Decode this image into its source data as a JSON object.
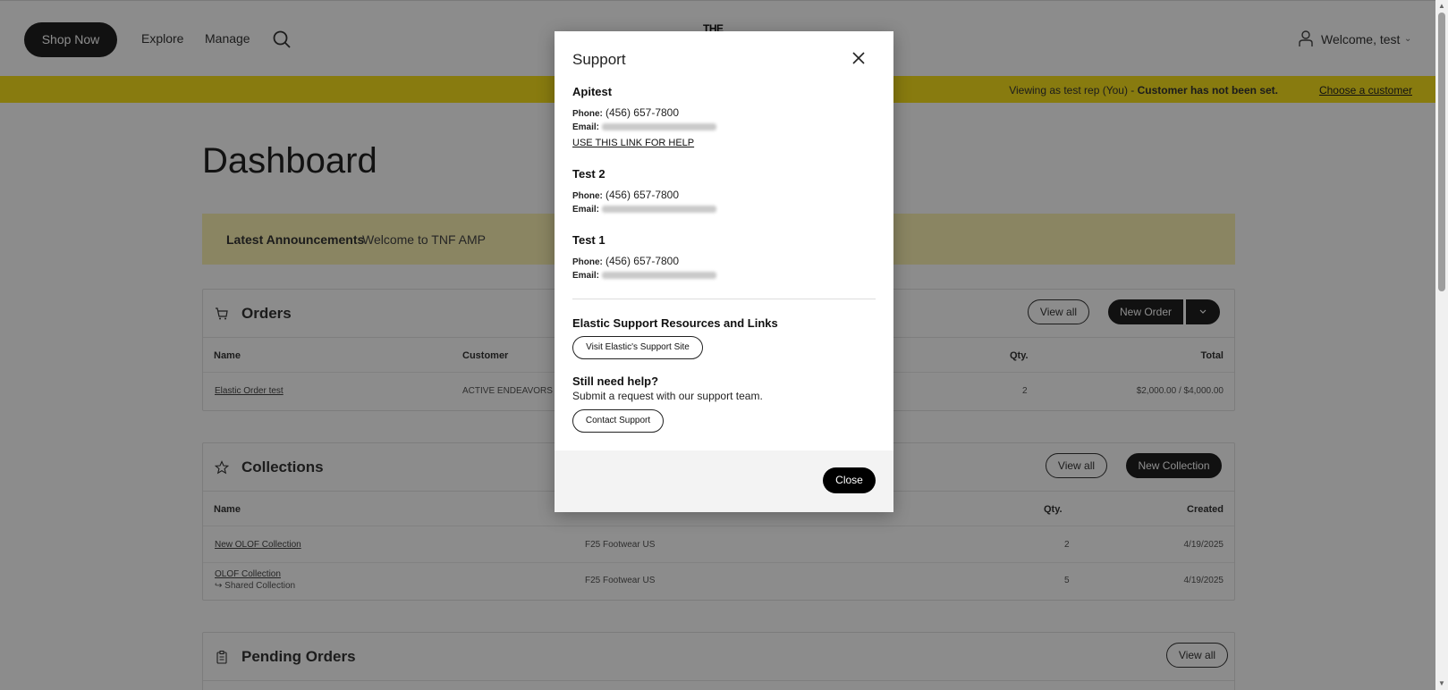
{
  "header": {
    "shop_now": "Shop Now",
    "explore": "Explore",
    "manage": "Manage",
    "logo_text": "THE",
    "welcome": "Welcome, test",
    "caret": "⌄"
  },
  "banner": {
    "viewing_as": "Viewing as test rep (You) - ",
    "customer_status": "Customer has not been set.",
    "choose_customer": "Choose a customer",
    "color": "#f7e11d"
  },
  "main": {
    "title": "Dashboard",
    "announcements": {
      "label": "Latest Announcements",
      "text": "Welcome to TNF AMP"
    }
  },
  "orders": {
    "title": "Orders",
    "view_all": "View all",
    "new_order": "New Order",
    "columns": {
      "name": "Name",
      "customer": "Customer",
      "qty": "Qty.",
      "total": "Total"
    },
    "rows": [
      {
        "name": "Elastic Order test",
        "customer": "ACTIVE ENDEAVORS O",
        "qty": "2",
        "total": "$2,000.00 / $4,000.00"
      }
    ]
  },
  "collections": {
    "title": "Collections",
    "view_all": "View all",
    "new_collection": "New Collection",
    "columns": {
      "name": "Name",
      "qty": "Qty.",
      "created": "Created"
    },
    "rows": [
      {
        "name": "New OLOF Collection",
        "sub": "",
        "catalog": "F25 Footwear US",
        "qty": "2",
        "created": "4/19/2025"
      },
      {
        "name": "OLOF Collection",
        "sub": "↪ Shared Collection",
        "catalog": "F25 Footwear US",
        "qty": "5",
        "created": "4/19/2025"
      }
    ]
  },
  "pending": {
    "title": "Pending Orders",
    "view_all": "View all"
  },
  "modal": {
    "title": "Support",
    "contacts": [
      {
        "name": "Apitest",
        "phone_label": "Phone:",
        "phone": "(456) 657-7800",
        "email_label": "Email:"
      },
      {
        "name": "Test 2",
        "phone_label": "Phone:",
        "phone": "(456) 657-7800",
        "email_label": "Email:"
      },
      {
        "name": "Test 1",
        "phone_label": "Phone:",
        "phone": "(456) 657-7800",
        "email_label": "Email:"
      }
    ],
    "help_link": "USE THIS LINK FOR HELP",
    "resources_title": "Elastic Support Resources and Links",
    "visit_button": "Visit Elastic's Support Site",
    "still_need_help": "Still need help?",
    "submit_text": "Submit a request with our support team.",
    "contact_button": "Contact Support",
    "close_button": "Close"
  }
}
